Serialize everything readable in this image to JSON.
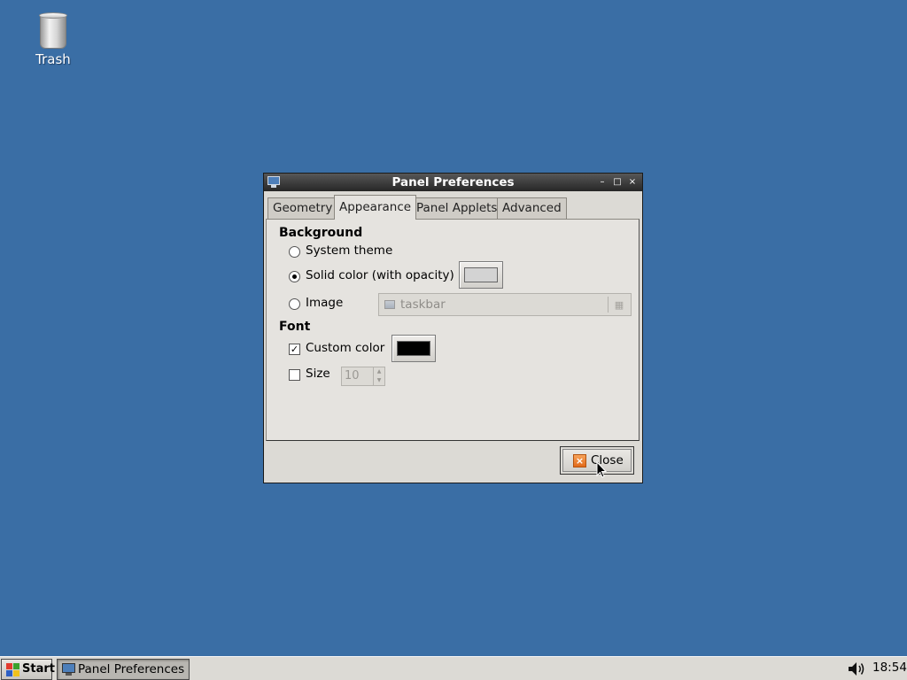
{
  "desktop": {
    "icons": [
      {
        "label": "Trash",
        "icon": "trash-icon"
      }
    ]
  },
  "window": {
    "title": "Panel Preferences",
    "controls": {
      "minimize": "–",
      "maximize": "□",
      "close": "×"
    },
    "tabs": [
      {
        "label": "Geometry",
        "active": false
      },
      {
        "label": "Appearance",
        "active": true
      },
      {
        "label": "Panel Applets",
        "active": false
      },
      {
        "label": "Advanced",
        "active": false
      }
    ],
    "background": {
      "heading": "Background",
      "options": [
        {
          "label": "System theme",
          "checked": false
        },
        {
          "label": "Solid color (with opacity)",
          "checked": true
        },
        {
          "label": "Image",
          "checked": false
        }
      ],
      "solid_color": "#d3d3d3",
      "image_file": {
        "value": "taskbar",
        "enabled": false
      }
    },
    "font": {
      "heading": "Font",
      "custom_color": {
        "label": "Custom color",
        "checked": true,
        "color": "#000000"
      },
      "size": {
        "label": "Size",
        "checked": false,
        "value": "10",
        "enabled": false
      }
    },
    "close_button": {
      "label": "Close",
      "icon": "close-icon"
    }
  },
  "taskbar": {
    "start_label": "Start",
    "tasks": [
      {
        "label": "Panel Preferences",
        "active": true
      }
    ],
    "clock": "18:54",
    "volume_icon": "volume-icon"
  },
  "colors": {
    "desktop": "#3a6ea5",
    "window_bg": "#dcdad5",
    "titlebar": "#3c3c3c",
    "accent": "#e26a1a"
  }
}
